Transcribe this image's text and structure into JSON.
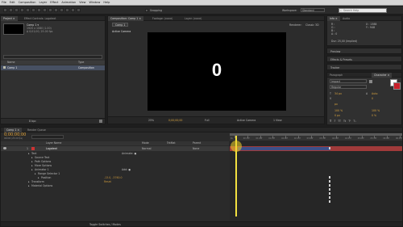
{
  "menubar": {
    "items": [
      "File",
      "Edit",
      "Composition",
      "Layer",
      "Effect",
      "Animation",
      "View",
      "Window",
      "Help"
    ]
  },
  "toolbar": {
    "snapping_label": "Snapping",
    "workspace_label": "Workspace:",
    "workspace_value": "Standard",
    "search_placeholder": "Search Help"
  },
  "project_panel": {
    "tabs": [
      "Project ×",
      "Effect Controls: Logotext"
    ],
    "comp_name": "Comp 1 ▾",
    "comp_info_lines": [
      "1920 x 1080 (1.00)",
      "Δ 0;01;00, 25.00 fps"
    ],
    "columns": {
      "name": "Name",
      "type": "Type"
    },
    "rows": [
      {
        "name": "Comp 1",
        "type": "Composition"
      }
    ],
    "footer_label": "8 bpc"
  },
  "composition_panel": {
    "tabs": [
      "Composition: Comp 1 ×",
      "Footage: (none)",
      "Layer: (none)"
    ],
    "comp_tab": "Comp 1",
    "renderer_label": "Renderer:",
    "renderer_value": "Classic 3D",
    "active_camera_label": "Active Camera",
    "canvas_text": "0",
    "bottom_controls": {
      "zoom": "25%",
      "timecode": "0;00;00;00",
      "resolution": "Full",
      "camera": "Active Camera",
      "views": "1 View"
    }
  },
  "info_panel": {
    "tabs": [
      "Info ×",
      "Audio"
    ],
    "lines": [
      "R :",
      "G :",
      "B :",
      "A : 0"
    ],
    "coords": [
      "X : 1388",
      "Y : 948"
    ],
    "status": "Dur: 25,00 (Implied)"
  },
  "side_panels": {
    "preview": "Preview",
    "effects": "Effects & Presets",
    "tracker": "Tracker",
    "paragraph": "Paragraph",
    "character": "Character ×"
  },
  "character_panel": {
    "font": "Impact",
    "style": "Regular",
    "size": "34 px",
    "leading": "Auto",
    "tracking": "0",
    "stroke": "px",
    "unit": "px",
    "scale_v": "100 %",
    "scale_h": "100 %",
    "baseline": "0 px",
    "tsume": "0 %",
    "style_buttons": [
      "T",
      "T",
      "TT",
      "Tt",
      "T¹",
      "T₁"
    ]
  },
  "timeline": {
    "tabs": [
      "Comp 1 ×",
      "Render Queue"
    ],
    "timecode": "0;00;00;00",
    "fps": "00000 (25.00 fps)",
    "headers": {
      "layer_name": "Layer Name",
      "mode": "Mode",
      "trkmat": "TrkMat",
      "parent": "Parent"
    },
    "layer": {
      "number": "1",
      "name": "Logotext",
      "mode": "Normal",
      "parent": "None"
    },
    "properties": [
      {
        "label": "Text",
        "value": "Animate: ●",
        "indent": 1
      },
      {
        "label": "Source Text",
        "value": "",
        "indent": 2
      },
      {
        "label": "Path Options",
        "value": "",
        "indent": 2
      },
      {
        "label": "More Options",
        "value": "",
        "indent": 2
      },
      {
        "label": "Animator 1",
        "value": "Add: ●",
        "indent": 2
      },
      {
        "label": "Range Selector 1",
        "value": "",
        "indent": 3
      },
      {
        "label": "Position",
        "value": "-13.0, -3760.0",
        "indent": 4
      },
      {
        "label": "Transform",
        "value": "Reset",
        "indent": 1
      },
      {
        "label": "Material Options",
        "value": "",
        "indent": 1
      }
    ],
    "ruler_labels": [
      "0s",
      "00:15f",
      "01:00f",
      "01:15f",
      "02:00f",
      "02:15f",
      "03:00f",
      "03:15f",
      "04:00f",
      "04:15f",
      "05:00f",
      "05:15f",
      "06:00f",
      "06:15f"
    ],
    "footer_label": "Toggle Switches / Modes"
  },
  "colors": {
    "accent_orange": "#e8a73c",
    "layer_bar_red": "#a03a3a",
    "work_area_blue": "#3d4f88",
    "cti_yellow": "#f2e040",
    "value_orange": "#c8953a"
  }
}
